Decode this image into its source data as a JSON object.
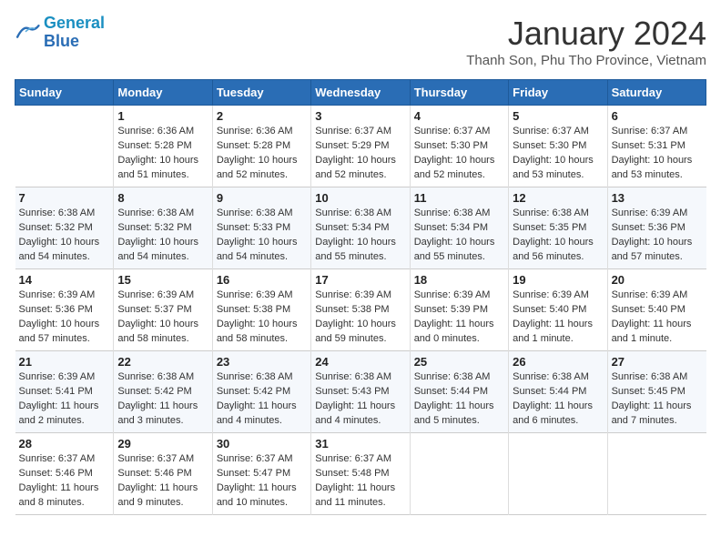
{
  "logo": {
    "line1": "General",
    "line2": "Blue"
  },
  "title": "January 2024",
  "location": "Thanh Son, Phu Tho Province, Vietnam",
  "weekdays": [
    "Sunday",
    "Monday",
    "Tuesday",
    "Wednesday",
    "Thursday",
    "Friday",
    "Saturday"
  ],
  "weeks": [
    [
      {
        "day": "",
        "sunrise": "",
        "sunset": "",
        "daylight": ""
      },
      {
        "day": "1",
        "sunrise": "Sunrise: 6:36 AM",
        "sunset": "Sunset: 5:28 PM",
        "daylight": "Daylight: 10 hours and 51 minutes."
      },
      {
        "day": "2",
        "sunrise": "Sunrise: 6:36 AM",
        "sunset": "Sunset: 5:28 PM",
        "daylight": "Daylight: 10 hours and 52 minutes."
      },
      {
        "day": "3",
        "sunrise": "Sunrise: 6:37 AM",
        "sunset": "Sunset: 5:29 PM",
        "daylight": "Daylight: 10 hours and 52 minutes."
      },
      {
        "day": "4",
        "sunrise": "Sunrise: 6:37 AM",
        "sunset": "Sunset: 5:30 PM",
        "daylight": "Daylight: 10 hours and 52 minutes."
      },
      {
        "day": "5",
        "sunrise": "Sunrise: 6:37 AM",
        "sunset": "Sunset: 5:30 PM",
        "daylight": "Daylight: 10 hours and 53 minutes."
      },
      {
        "day": "6",
        "sunrise": "Sunrise: 6:37 AM",
        "sunset": "Sunset: 5:31 PM",
        "daylight": "Daylight: 10 hours and 53 minutes."
      }
    ],
    [
      {
        "day": "7",
        "sunrise": "Sunrise: 6:38 AM",
        "sunset": "Sunset: 5:32 PM",
        "daylight": "Daylight: 10 hours and 54 minutes."
      },
      {
        "day": "8",
        "sunrise": "Sunrise: 6:38 AM",
        "sunset": "Sunset: 5:32 PM",
        "daylight": "Daylight: 10 hours and 54 minutes."
      },
      {
        "day": "9",
        "sunrise": "Sunrise: 6:38 AM",
        "sunset": "Sunset: 5:33 PM",
        "daylight": "Daylight: 10 hours and 54 minutes."
      },
      {
        "day": "10",
        "sunrise": "Sunrise: 6:38 AM",
        "sunset": "Sunset: 5:34 PM",
        "daylight": "Daylight: 10 hours and 55 minutes."
      },
      {
        "day": "11",
        "sunrise": "Sunrise: 6:38 AM",
        "sunset": "Sunset: 5:34 PM",
        "daylight": "Daylight: 10 hours and 55 minutes."
      },
      {
        "day": "12",
        "sunrise": "Sunrise: 6:38 AM",
        "sunset": "Sunset: 5:35 PM",
        "daylight": "Daylight: 10 hours and 56 minutes."
      },
      {
        "day": "13",
        "sunrise": "Sunrise: 6:39 AM",
        "sunset": "Sunset: 5:36 PM",
        "daylight": "Daylight: 10 hours and 57 minutes."
      }
    ],
    [
      {
        "day": "14",
        "sunrise": "Sunrise: 6:39 AM",
        "sunset": "Sunset: 5:36 PM",
        "daylight": "Daylight: 10 hours and 57 minutes."
      },
      {
        "day": "15",
        "sunrise": "Sunrise: 6:39 AM",
        "sunset": "Sunset: 5:37 PM",
        "daylight": "Daylight: 10 hours and 58 minutes."
      },
      {
        "day": "16",
        "sunrise": "Sunrise: 6:39 AM",
        "sunset": "Sunset: 5:38 PM",
        "daylight": "Daylight: 10 hours and 58 minutes."
      },
      {
        "day": "17",
        "sunrise": "Sunrise: 6:39 AM",
        "sunset": "Sunset: 5:38 PM",
        "daylight": "Daylight: 10 hours and 59 minutes."
      },
      {
        "day": "18",
        "sunrise": "Sunrise: 6:39 AM",
        "sunset": "Sunset: 5:39 PM",
        "daylight": "Daylight: 11 hours and 0 minutes."
      },
      {
        "day": "19",
        "sunrise": "Sunrise: 6:39 AM",
        "sunset": "Sunset: 5:40 PM",
        "daylight": "Daylight: 11 hours and 1 minute."
      },
      {
        "day": "20",
        "sunrise": "Sunrise: 6:39 AM",
        "sunset": "Sunset: 5:40 PM",
        "daylight": "Daylight: 11 hours and 1 minute."
      }
    ],
    [
      {
        "day": "21",
        "sunrise": "Sunrise: 6:39 AM",
        "sunset": "Sunset: 5:41 PM",
        "daylight": "Daylight: 11 hours and 2 minutes."
      },
      {
        "day": "22",
        "sunrise": "Sunrise: 6:38 AM",
        "sunset": "Sunset: 5:42 PM",
        "daylight": "Daylight: 11 hours and 3 minutes."
      },
      {
        "day": "23",
        "sunrise": "Sunrise: 6:38 AM",
        "sunset": "Sunset: 5:42 PM",
        "daylight": "Daylight: 11 hours and 4 minutes."
      },
      {
        "day": "24",
        "sunrise": "Sunrise: 6:38 AM",
        "sunset": "Sunset: 5:43 PM",
        "daylight": "Daylight: 11 hours and 4 minutes."
      },
      {
        "day": "25",
        "sunrise": "Sunrise: 6:38 AM",
        "sunset": "Sunset: 5:44 PM",
        "daylight": "Daylight: 11 hours and 5 minutes."
      },
      {
        "day": "26",
        "sunrise": "Sunrise: 6:38 AM",
        "sunset": "Sunset: 5:44 PM",
        "daylight": "Daylight: 11 hours and 6 minutes."
      },
      {
        "day": "27",
        "sunrise": "Sunrise: 6:38 AM",
        "sunset": "Sunset: 5:45 PM",
        "daylight": "Daylight: 11 hours and 7 minutes."
      }
    ],
    [
      {
        "day": "28",
        "sunrise": "Sunrise: 6:37 AM",
        "sunset": "Sunset: 5:46 PM",
        "daylight": "Daylight: 11 hours and 8 minutes."
      },
      {
        "day": "29",
        "sunrise": "Sunrise: 6:37 AM",
        "sunset": "Sunset: 5:46 PM",
        "daylight": "Daylight: 11 hours and 9 minutes."
      },
      {
        "day": "30",
        "sunrise": "Sunrise: 6:37 AM",
        "sunset": "Sunset: 5:47 PM",
        "daylight": "Daylight: 11 hours and 10 minutes."
      },
      {
        "day": "31",
        "sunrise": "Sunrise: 6:37 AM",
        "sunset": "Sunset: 5:48 PM",
        "daylight": "Daylight: 11 hours and 11 minutes."
      },
      {
        "day": "",
        "sunrise": "",
        "sunset": "",
        "daylight": ""
      },
      {
        "day": "",
        "sunrise": "",
        "sunset": "",
        "daylight": ""
      },
      {
        "day": "",
        "sunrise": "",
        "sunset": "",
        "daylight": ""
      }
    ]
  ]
}
